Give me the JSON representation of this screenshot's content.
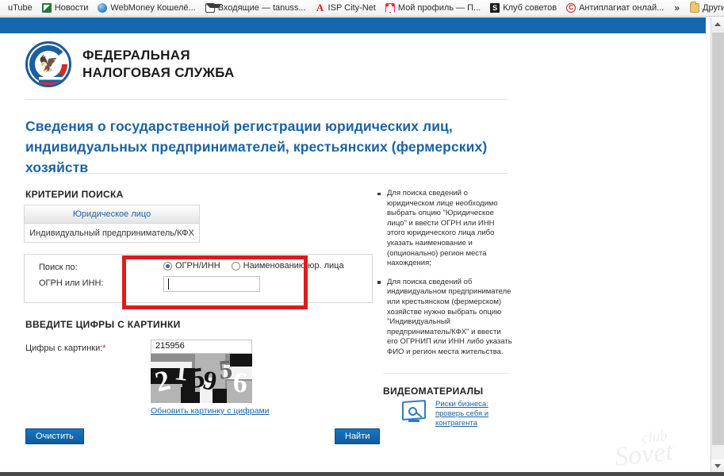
{
  "browser": {
    "bookmarks": [
      {
        "label": "uTube",
        "icon": "youtube-icon",
        "icon_class": "none"
      },
      {
        "label": "Новости",
        "icon": "news-icon",
        "icon_class": "ico-news"
      },
      {
        "label": "WebMoney Кошелё...",
        "icon": "webmoney-icon",
        "icon_class": "ico-wm"
      },
      {
        "label": "Входящие — tanuss...",
        "icon": "mail-icon",
        "icon_class": "ico-mail"
      },
      {
        "label": "ISP City-Net",
        "icon": "isp-city-net-icon",
        "icon_class": "ico-isp",
        "glyph": "A"
      },
      {
        "label": "Мой профиль — П...",
        "icon": "profile-icon",
        "icon_class": "ico-profile"
      },
      {
        "label": "Клуб советов",
        "icon": "club-sovetov-icon",
        "icon_class": "ico-club",
        "glyph": "S"
      },
      {
        "label": "Антиплагиат онлай...",
        "icon": "antiplagiat-icon",
        "icon_class": "ico-anti",
        "glyph": "C"
      }
    ],
    "overflow_glyph": "»",
    "other_bookmarks": {
      "label": "Другие закладки",
      "icon": "folder-icon"
    }
  },
  "site": {
    "org_name_line1": "ФЕДЕРАЛЬНАЯ",
    "org_name_line2": "НАЛОГОВАЯ СЛУЖБА",
    "emblem_name": "fns-emblem-icon",
    "page_title": "Сведения о государственной регистрации юридических лиц, индивидуальных предпринимателей, крестьянских (фермерских) хозяйств",
    "accent_color": "#1b63a5",
    "topbar_color": "#1567ae"
  },
  "criteria": {
    "heading": "КРИТЕРИИ ПОИСКА",
    "tabs": [
      {
        "label": "Юридическое лицо",
        "active": true
      },
      {
        "label": "Индивидуальный предприниматель/КФХ",
        "active": false
      }
    ],
    "search_by_label": "Поиск по:",
    "ogrn_label": "ОГРН или ИНН:",
    "radio_options": [
      {
        "label": "ОГРН/ИНН",
        "checked": true
      },
      {
        "label": "Наименованию юр. лица",
        "checked": false
      }
    ],
    "ogrn_input_value": "",
    "ogrn_input_placeholder": "",
    "highlight_color": "#e01b1b"
  },
  "captcha": {
    "heading": "ВВЕДИТЕ ЦИФРЫ С КАРТИНКИ",
    "field_label": "Цифры с картинки:",
    "required_mark": "*",
    "entered_value": "215956",
    "image_digits": "215956",
    "refresh_link": "Обновить картинку с цифрами"
  },
  "buttons": {
    "clear": "Очистить",
    "search": "Найти"
  },
  "sidebar": {
    "hints": [
      "Для поиска сведений о юридическом лице необходимо выбрать опцию \"Юридическое лицо\" и ввести ОГРН или ИНН этого юридического лица либо указать наименование и (опционально) регион места нахождения;",
      "Для поиска сведений об индивидуальном предпринимателе или крестьянском (фермерском) хозяйстве нужно выбрать опцию \"Индивидуальный предприниматель/КФХ\" и ввести его ОГРНИП или ИНН либо указать ФИО и регион места жительства."
    ],
    "video_heading": "ВИДЕОМАТЕРИАЛЫ",
    "video_link": "Риски бизнеса: проверь себя и контрагента",
    "video_icon": "monitor-magnifier-icon"
  },
  "watermark": {
    "line1": "club",
    "line2": "Sovet"
  },
  "scrollbar": {
    "up_arrow": "scroll-up-arrow",
    "down_arrow": "scroll-down-arrow"
  }
}
